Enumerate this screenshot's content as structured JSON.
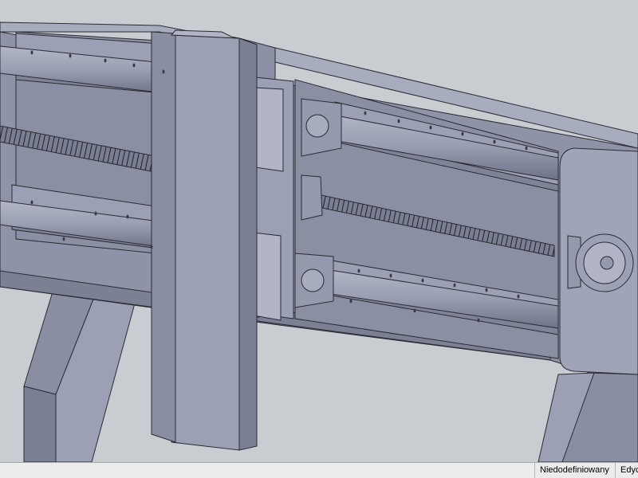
{
  "window": {
    "title": ""
  },
  "statusbar": {
    "definition_state": "Niedodefiniowany",
    "edit_mode": "Edyc"
  },
  "colors": {
    "background": "#c9ccd1",
    "part_face": "#8f93a8",
    "part_face_light": "#a4a8bb",
    "part_face_dark": "#6e7288",
    "edge": "#2a2b33"
  },
  "viewport": {
    "kind": "3D CAD model view",
    "subject": "linear axis assembly with guide rods and lead screw"
  }
}
